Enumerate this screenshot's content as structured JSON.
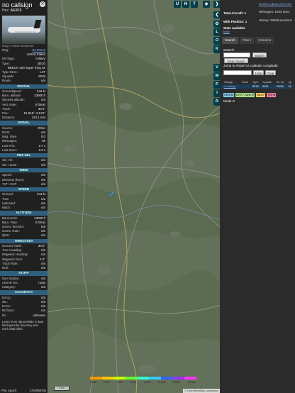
{
  "aircraft": {
    "callsign": "no callsign",
    "hex_label": "Hex:",
    "hex": "AE0F9",
    "image_credit": "Image © Stefan Rönnebroek",
    "fields": [
      {
        "k": "Reg.:",
        "v": "84-00175",
        "link": true
      },
      {
        "k": "",
        "v": "United States"
      },
      {
        "k": "DB flags:",
        "v": "military"
      },
      {
        "k": "Type:",
        "v": "BE20"
      },
      {
        "k": "",
        "v": "BEECH 200 Super King Air"
      },
      {
        "k": "Type Desc.:",
        "v": "L2T"
      },
      {
        "k": "Squawk:",
        "v": "5036"
      },
      {
        "k": "Route:",
        "v": "n/a"
      }
    ]
  },
  "sections": [
    {
      "title": "SPATIAL",
      "rows": [
        {
          "k": "Groundspeed:",
          "v": "244 kt"
        },
        {
          "k": "Baro. altitude:",
          "v": "23000 ft"
        },
        {
          "k": "WGS84 altitude:",
          "v": "n/a"
        },
        {
          "k": "Vert. Rate:",
          "v": "0 ft/min"
        },
        {
          "k": "Track:",
          "v": "30.0°"
        },
        {
          "k": "Pos.:",
          "v": "51.919°, 8.574°"
        },
        {
          "k": "Distance:",
          "v": "153.1 nmi"
        }
      ]
    },
    {
      "title": "SIGNAL",
      "rows": [
        {
          "k": "Source:",
          "v": "Other"
        },
        {
          "k": "RSSI:",
          "v": "n/a"
        },
        {
          "k": "Msg. Rate:",
          "v": "0.0"
        },
        {
          "k": "Messages:",
          "v": "59"
        },
        {
          "k": "Last Pos.:",
          "v": "2.7 s"
        },
        {
          "k": "Last Seen:",
          "v": "2.2 s"
        }
      ]
    },
    {
      "title": "FMS SEL",
      "rows": [
        {
          "k": "Sel. Alt.:",
          "v": "n/a"
        },
        {
          "k": "Sel. Head.:",
          "v": "n/a"
        }
      ]
    },
    {
      "title": "WIND",
      "rows": [
        {
          "k": "Speed:",
          "v": "n/a"
        },
        {
          "k": "Direction (from):",
          "v": "n/a"
        },
        {
          "k": "TAT / OAT:",
          "v": "n/a"
        }
      ]
    },
    {
      "title": "SPEED",
      "rows": [
        {
          "k": "Ground:",
          "v": "244 kt"
        },
        {
          "k": "True:",
          "v": "n/a"
        },
        {
          "k": "Indicated:",
          "v": "n/a"
        },
        {
          "k": "Mach:",
          "v": "n/a"
        }
      ]
    },
    {
      "title": "ALTITUDE",
      "rows": [
        {
          "k": "Barometric:",
          "v": "23000 ft"
        },
        {
          "k": "Baro. Rate:",
          "v": "0 ft/min"
        },
        {
          "k": "Geom. WGS84:",
          "v": "n/a"
        },
        {
          "k": "Geom. Rate:",
          "v": "n/a"
        },
        {
          "k": "QNH:",
          "v": "n/a"
        }
      ]
    },
    {
      "title": "DIRECTION",
      "rows": [
        {
          "k": "Ground Track:",
          "v": "30.0°"
        },
        {
          "k": "True Heading:",
          "v": "n/a"
        },
        {
          "k": "Magnetic Heading:",
          "v": "n/a"
        },
        {
          "k": "Magnetic Decl.:",
          "v": "4.0°"
        },
        {
          "k": "Track Rate:",
          "v": "n/a"
        },
        {
          "k": "Roll:",
          "v": "n/a"
        }
      ]
    },
    {
      "title": "STUFF",
      "rows": [
        {
          "k": "Nav. Modes:",
          "v": "n/a"
        },
        {
          "k": "ADS-B Ver.:",
          "v": "none"
        },
        {
          "k": "Category:",
          "v": "n/a"
        }
      ]
    },
    {
      "title": "ACCURACY",
      "rows": [
        {
          "k": "NACp:",
          "v": "n/a"
        },
        {
          "k": "SIL:",
          "v": "n/a"
        },
        {
          "k": "NACv:",
          "v": "n/a"
        },
        {
          "k": "NICbaro:",
          "v": "n/a"
        },
        {
          "k": "Rc:",
          "v": "unknown"
        }
      ]
    }
  ],
  "learn_more": "Learn more about Mode S data field types by hovering over each data label.",
  "pos_epoch": {
    "k": "Pos. epoch:",
    "v": "1742986764"
  },
  "map": {
    "top_buttons": [
      "U",
      "H",
      "T"
    ],
    "side_buttons": [
      "L",
      "O",
      "K",
      "V",
      "M",
      "P",
      "I",
      "R"
    ],
    "legend_colors": [
      "#ff9900",
      "#ffcc00",
      "#ccff00",
      "#66ff33",
      "#33ffcc",
      "#33ccff",
      "#3366ff",
      "#9933ff",
      "#ff33ff"
    ],
    "legend_labels": [
      "2,000",
      "4,000",
      "6,000",
      "8,000",
      "10,000",
      "20,000",
      "30,000",
      "40,000+"
    ],
    "scale": "5 nm",
    "attribution": "© OpenStreetMap contributors"
  },
  "right": {
    "version": "tar1090 on github (3.14.1793)",
    "total_aircraft": "Total Aircraft: 1",
    "messages": "Messages: 1594.1/sec",
    "with_position": "With Position: 1",
    "history": "History: 29268 positions",
    "stats": "Stats available",
    "stats_link": "here",
    "tabs": [
      "Search",
      "Filters",
      "Columns"
    ],
    "search_label": "Search:",
    "search_button": "Search",
    "clear_search": "Clear Search",
    "jump_label": "Jump to Airport or Latitude, Longitude:",
    "jump_button": "Jump",
    "clear_button": "Clear",
    "columns": [
      "",
      "Callsign",
      "Route",
      "Type",
      "Squawk",
      "Alt. (ft)",
      "Sp"
    ],
    "row": [
      "",
      "no callsign",
      "",
      "BE20",
      "5036",
      "23000",
      "24"
    ],
    "sources": [
      {
        "label": "ADS-B",
        "color": "#7ec8e3"
      },
      {
        "label": "UAT / ADS-R",
        "color": "#aadd88"
      },
      {
        "label": "MLAT",
        "color": "#ffcc66"
      },
      {
        "label": "TIS-B",
        "color": "#f07ea0"
      }
    ],
    "modes": "Mode-S"
  }
}
